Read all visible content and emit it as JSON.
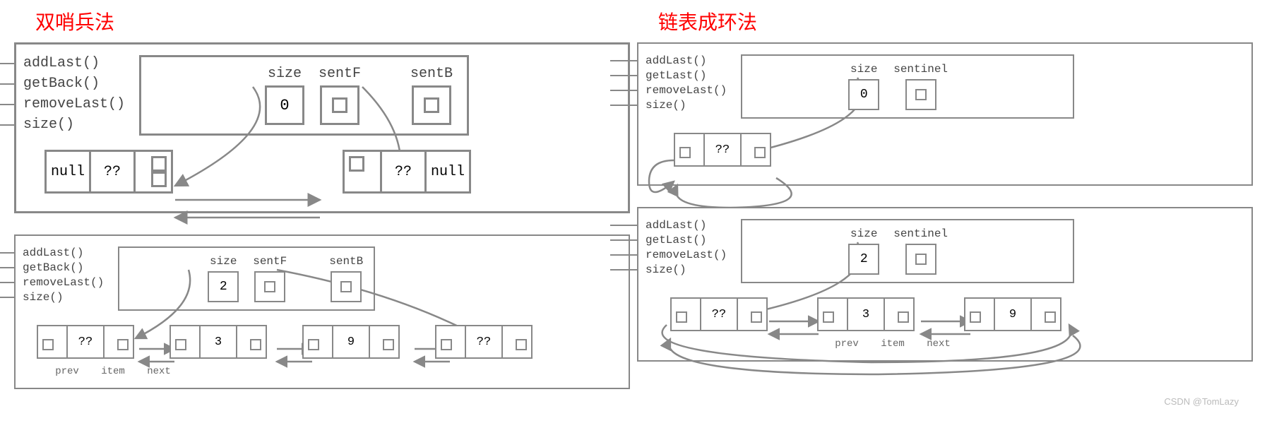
{
  "left": {
    "title": "双哨兵法",
    "d1": {
      "methods": [
        "addLast()",
        "getBack()",
        "removeLast()",
        "size()"
      ],
      "size_label": "size",
      "size_val": "0",
      "sentF_label": "sentF",
      "sentB_label": "sentB",
      "node1": {
        "prev": "null",
        "item": "??"
      },
      "node2": {
        "item": "??",
        "next": "null"
      }
    },
    "d2": {
      "methods": [
        "addLast()",
        "getBack()",
        "removeLast()",
        "size()"
      ],
      "size_label": "size",
      "size_val": "2",
      "sentF_label": "sentF",
      "sentB_label": "sentB",
      "nodes": [
        {
          "item": "??"
        },
        {
          "item": "3"
        },
        {
          "item": "9"
        },
        {
          "item": "??"
        }
      ],
      "sublabels": [
        "prev",
        "item",
        "next"
      ]
    }
  },
  "right": {
    "title": "链表成环法",
    "d1": {
      "methods": [
        "addLast()",
        "getLast()",
        "removeLast()",
        "size()"
      ],
      "size_label": "size",
      "size_val": "0",
      "sentinel_label": "sentinel",
      "node": {
        "item": "??"
      }
    },
    "d2": {
      "methods": [
        "addLast()",
        "getLast()",
        "removeLast()",
        "size()"
      ],
      "size_label": "size",
      "size_val": "2",
      "sentinel_label": "sentinel",
      "nodes": [
        {
          "item": "??"
        },
        {
          "item": "3"
        },
        {
          "item": "9"
        }
      ],
      "sublabels": [
        "prev",
        "item",
        "next"
      ]
    }
  },
  "watermark": "CSDN @TomLazy"
}
